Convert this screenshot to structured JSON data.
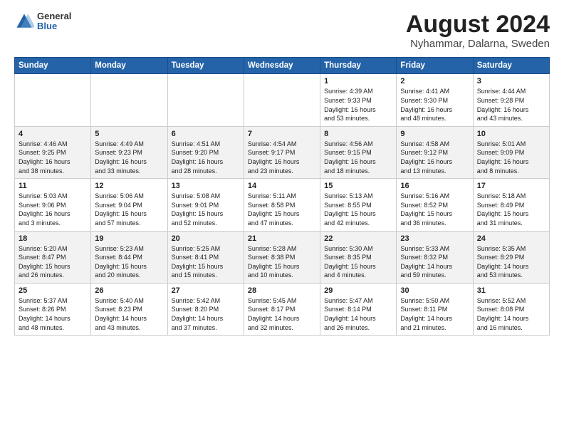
{
  "logo": {
    "general": "General",
    "blue": "Blue"
  },
  "title": "August 2024",
  "subtitle": "Nyhammar, Dalarna, Sweden",
  "days_of_week": [
    "Sunday",
    "Monday",
    "Tuesday",
    "Wednesday",
    "Thursday",
    "Friday",
    "Saturday"
  ],
  "weeks": [
    [
      {
        "day": "",
        "info": ""
      },
      {
        "day": "",
        "info": ""
      },
      {
        "day": "",
        "info": ""
      },
      {
        "day": "",
        "info": ""
      },
      {
        "day": "1",
        "info": "Sunrise: 4:39 AM\nSunset: 9:33 PM\nDaylight: 16 hours\nand 53 minutes."
      },
      {
        "day": "2",
        "info": "Sunrise: 4:41 AM\nSunset: 9:30 PM\nDaylight: 16 hours\nand 48 minutes."
      },
      {
        "day": "3",
        "info": "Sunrise: 4:44 AM\nSunset: 9:28 PM\nDaylight: 16 hours\nand 43 minutes."
      }
    ],
    [
      {
        "day": "4",
        "info": "Sunrise: 4:46 AM\nSunset: 9:25 PM\nDaylight: 16 hours\nand 38 minutes."
      },
      {
        "day": "5",
        "info": "Sunrise: 4:49 AM\nSunset: 9:23 PM\nDaylight: 16 hours\nand 33 minutes."
      },
      {
        "day": "6",
        "info": "Sunrise: 4:51 AM\nSunset: 9:20 PM\nDaylight: 16 hours\nand 28 minutes."
      },
      {
        "day": "7",
        "info": "Sunrise: 4:54 AM\nSunset: 9:17 PM\nDaylight: 16 hours\nand 23 minutes."
      },
      {
        "day": "8",
        "info": "Sunrise: 4:56 AM\nSunset: 9:15 PM\nDaylight: 16 hours\nand 18 minutes."
      },
      {
        "day": "9",
        "info": "Sunrise: 4:58 AM\nSunset: 9:12 PM\nDaylight: 16 hours\nand 13 minutes."
      },
      {
        "day": "10",
        "info": "Sunrise: 5:01 AM\nSunset: 9:09 PM\nDaylight: 16 hours\nand 8 minutes."
      }
    ],
    [
      {
        "day": "11",
        "info": "Sunrise: 5:03 AM\nSunset: 9:06 PM\nDaylight: 16 hours\nand 3 minutes."
      },
      {
        "day": "12",
        "info": "Sunrise: 5:06 AM\nSunset: 9:04 PM\nDaylight: 15 hours\nand 57 minutes."
      },
      {
        "day": "13",
        "info": "Sunrise: 5:08 AM\nSunset: 9:01 PM\nDaylight: 15 hours\nand 52 minutes."
      },
      {
        "day": "14",
        "info": "Sunrise: 5:11 AM\nSunset: 8:58 PM\nDaylight: 15 hours\nand 47 minutes."
      },
      {
        "day": "15",
        "info": "Sunrise: 5:13 AM\nSunset: 8:55 PM\nDaylight: 15 hours\nand 42 minutes."
      },
      {
        "day": "16",
        "info": "Sunrise: 5:16 AM\nSunset: 8:52 PM\nDaylight: 15 hours\nand 36 minutes."
      },
      {
        "day": "17",
        "info": "Sunrise: 5:18 AM\nSunset: 8:49 PM\nDaylight: 15 hours\nand 31 minutes."
      }
    ],
    [
      {
        "day": "18",
        "info": "Sunrise: 5:20 AM\nSunset: 8:47 PM\nDaylight: 15 hours\nand 26 minutes."
      },
      {
        "day": "19",
        "info": "Sunrise: 5:23 AM\nSunset: 8:44 PM\nDaylight: 15 hours\nand 20 minutes."
      },
      {
        "day": "20",
        "info": "Sunrise: 5:25 AM\nSunset: 8:41 PM\nDaylight: 15 hours\nand 15 minutes."
      },
      {
        "day": "21",
        "info": "Sunrise: 5:28 AM\nSunset: 8:38 PM\nDaylight: 15 hours\nand 10 minutes."
      },
      {
        "day": "22",
        "info": "Sunrise: 5:30 AM\nSunset: 8:35 PM\nDaylight: 15 hours\nand 4 minutes."
      },
      {
        "day": "23",
        "info": "Sunrise: 5:33 AM\nSunset: 8:32 PM\nDaylight: 14 hours\nand 59 minutes."
      },
      {
        "day": "24",
        "info": "Sunrise: 5:35 AM\nSunset: 8:29 PM\nDaylight: 14 hours\nand 53 minutes."
      }
    ],
    [
      {
        "day": "25",
        "info": "Sunrise: 5:37 AM\nSunset: 8:26 PM\nDaylight: 14 hours\nand 48 minutes."
      },
      {
        "day": "26",
        "info": "Sunrise: 5:40 AM\nSunset: 8:23 PM\nDaylight: 14 hours\nand 43 minutes."
      },
      {
        "day": "27",
        "info": "Sunrise: 5:42 AM\nSunset: 8:20 PM\nDaylight: 14 hours\nand 37 minutes."
      },
      {
        "day": "28",
        "info": "Sunrise: 5:45 AM\nSunset: 8:17 PM\nDaylight: 14 hours\nand 32 minutes."
      },
      {
        "day": "29",
        "info": "Sunrise: 5:47 AM\nSunset: 8:14 PM\nDaylight: 14 hours\nand 26 minutes."
      },
      {
        "day": "30",
        "info": "Sunrise: 5:50 AM\nSunset: 8:11 PM\nDaylight: 14 hours\nand 21 minutes."
      },
      {
        "day": "31",
        "info": "Sunrise: 5:52 AM\nSunset: 8:08 PM\nDaylight: 14 hours\nand 16 minutes."
      }
    ]
  ]
}
